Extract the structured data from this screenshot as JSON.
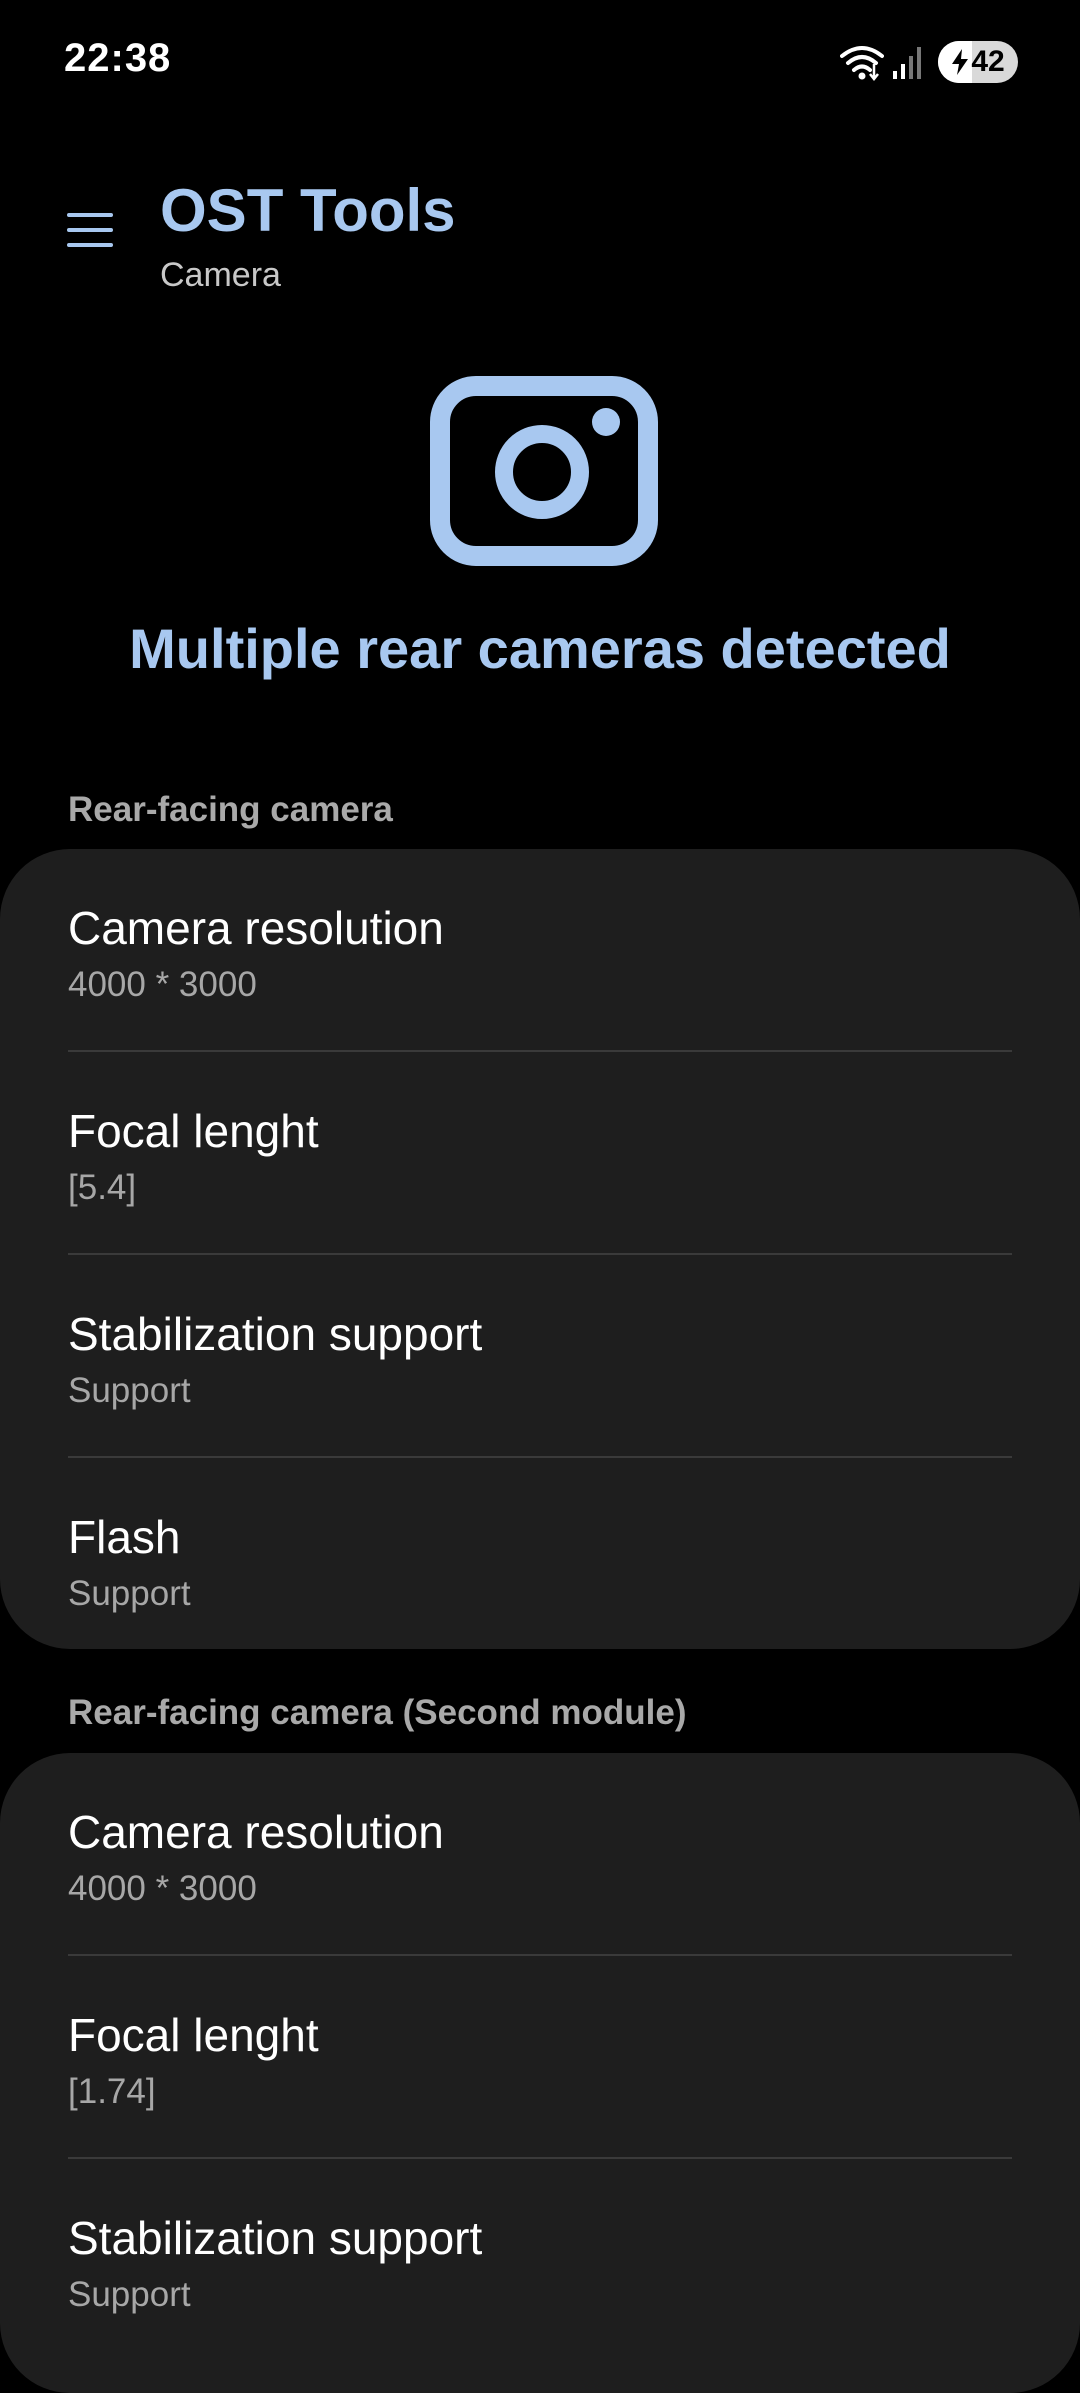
{
  "status_bar": {
    "time": "22:38",
    "battery": "42",
    "battery_level": 0.42
  },
  "header": {
    "title": "OST Tools",
    "subtitle": "Camera"
  },
  "hero": {
    "icon": "camera-icon",
    "text": "Multiple rear cameras detected"
  },
  "sections": [
    {
      "label": "Rear-facing camera",
      "items": [
        {
          "title": "Camera resolution",
          "value": "4000 * 3000"
        },
        {
          "title": "Focal lenght",
          "value": "[5.4]"
        },
        {
          "title": "Stabilization support",
          "value": "Support"
        },
        {
          "title": "Flash",
          "value": "Support"
        }
      ]
    },
    {
      "label": "Rear-facing camera (Second module)",
      "items": [
        {
          "title": "Camera resolution",
          "value": "4000 * 3000"
        },
        {
          "title": "Focal lenght",
          "value": "[1.74]"
        },
        {
          "title": "Stabilization support",
          "value": "Support"
        }
      ]
    }
  ],
  "colors": {
    "accent": "#a8c8f0",
    "card": "#1e1e1e",
    "background": "#000000"
  }
}
